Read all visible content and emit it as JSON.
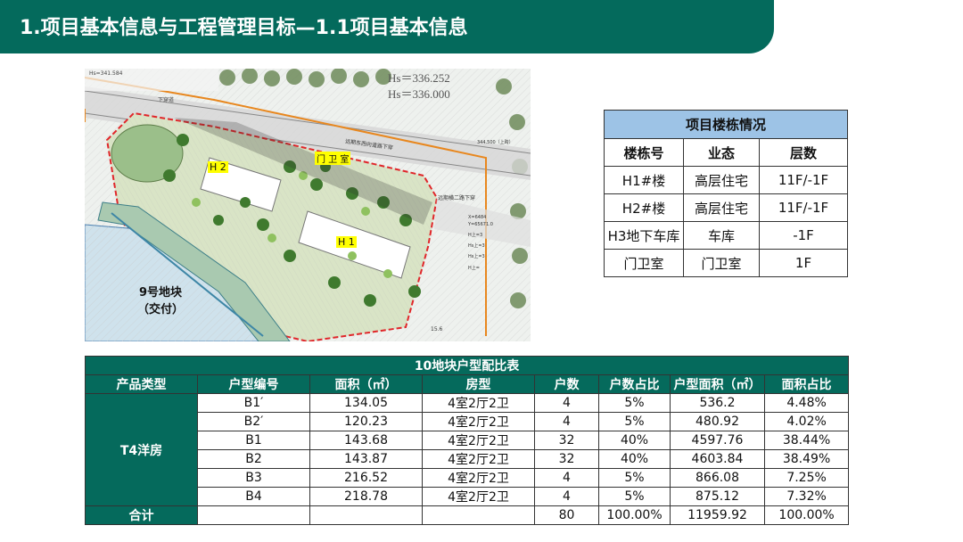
{
  "title": "1.项目基本信息与工程管理目标—1.1项目基本信息",
  "site_plan": {
    "label_h1": "H 1",
    "label_h2": "H 2",
    "label_gate": "门 卫 室",
    "plot_label_line1": "9号地块",
    "plot_label_line2": "（交付）",
    "survey_hs1": "Hs＝336.252",
    "survey_hs2": "Hs＝336.000",
    "survey_small": "Hs=341.584",
    "road_label": "下穿道",
    "road_label2": "远期东西向道路下穿",
    "road_label3": "远期横二路下穿",
    "elev": "344.500（上跨）",
    "coord1": "X=6484",
    "coord2": "Y=65671.0",
    "hs_small1": "H上=3",
    "hs_small2": "Hs上=3",
    "hs_small3": "Hs上=3",
    "hs_small4": "H上=",
    "scale_num": "15.6"
  },
  "building_table": {
    "caption": "项目楼栋情况",
    "headers": [
      "楼栋号",
      "业态",
      "层数"
    ],
    "rows": [
      [
        "H1#楼",
        "高层住宅",
        "11F/-1F"
      ],
      [
        "H2#楼",
        "高层住宅",
        "11F/-1F"
      ],
      [
        "H3地下车库",
        "车库",
        "-1F"
      ],
      [
        "门卫室",
        "门卫室",
        "1F"
      ]
    ]
  },
  "mix_table": {
    "caption": "10地块户型配比表",
    "headers": [
      "产品类型",
      "户型编号",
      "面积（㎡）",
      "房型",
      "户数",
      "户数占比",
      "户型面积（㎡）",
      "面积占比"
    ],
    "group": "T4洋房",
    "rows": [
      [
        "B1′",
        "134.05",
        "4室2厅2卫",
        "4",
        "5%",
        "536.2",
        "4.48%"
      ],
      [
        "B2′",
        "120.23",
        "4室2厅2卫",
        "4",
        "5%",
        "480.92",
        "4.02%"
      ],
      [
        "B1",
        "143.68",
        "4室2厅2卫",
        "32",
        "40%",
        "4597.76",
        "38.44%"
      ],
      [
        "B2",
        "143.87",
        "4室2厅2卫",
        "32",
        "40%",
        "4603.84",
        "38.49%"
      ],
      [
        "B3",
        "216.52",
        "4室2厅2卫",
        "4",
        "5%",
        "866.08",
        "7.25%"
      ],
      [
        "B4",
        "218.78",
        "4室2厅2卫",
        "4",
        "5%",
        "875.12",
        "7.32%"
      ]
    ],
    "total": {
      "label": "合计",
      "count": "80",
      "count_ratio": "100.00%",
      "area": "11959.92",
      "area_ratio": "100.00%"
    }
  }
}
